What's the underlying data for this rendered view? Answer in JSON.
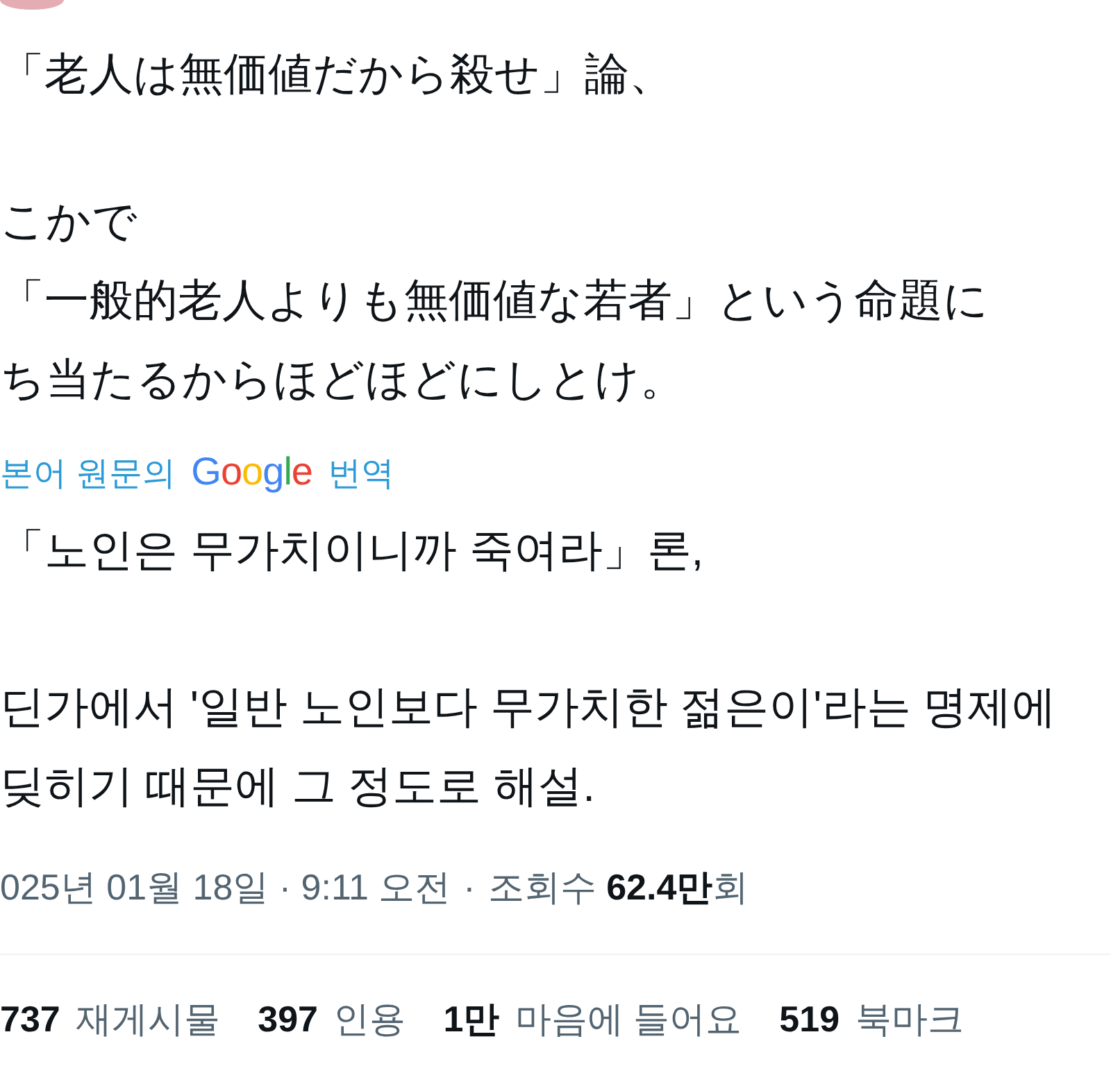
{
  "original_text": {
    "paragraphs": [
      [
        "「老人は無価値だから殺せ」論、"
      ],
      [
        "こかで",
        "「一般的老人よりも無価値な若者」という命題に",
        "ち当たるからほどほどにしとけ。"
      ]
    ]
  },
  "translation": {
    "prefix": "본어 원문의",
    "logo": "Google",
    "suffix": "번역"
  },
  "translated_text": {
    "paragraphs": [
      [
        "「노인은 무가치이니까 죽여라」론,"
      ],
      [
        "딘가에서 '일반 노인보다 무가치한 젊은이'라는 명제에",
        "딪히기 때문에 그 정도로 해설."
      ]
    ]
  },
  "meta": {
    "timestamp": "025년 01월 18일 · 9:11 오전",
    "separator": "·",
    "views": "조회수 **62.4만**회"
  },
  "stats": [
    {
      "count": "737",
      "label": "재게시물"
    },
    {
      "count": "397",
      "label": "인용"
    },
    {
      "count": "1만",
      "label": "마음에 들어요"
    },
    {
      "count": "519",
      "label": "북마크"
    }
  ]
}
